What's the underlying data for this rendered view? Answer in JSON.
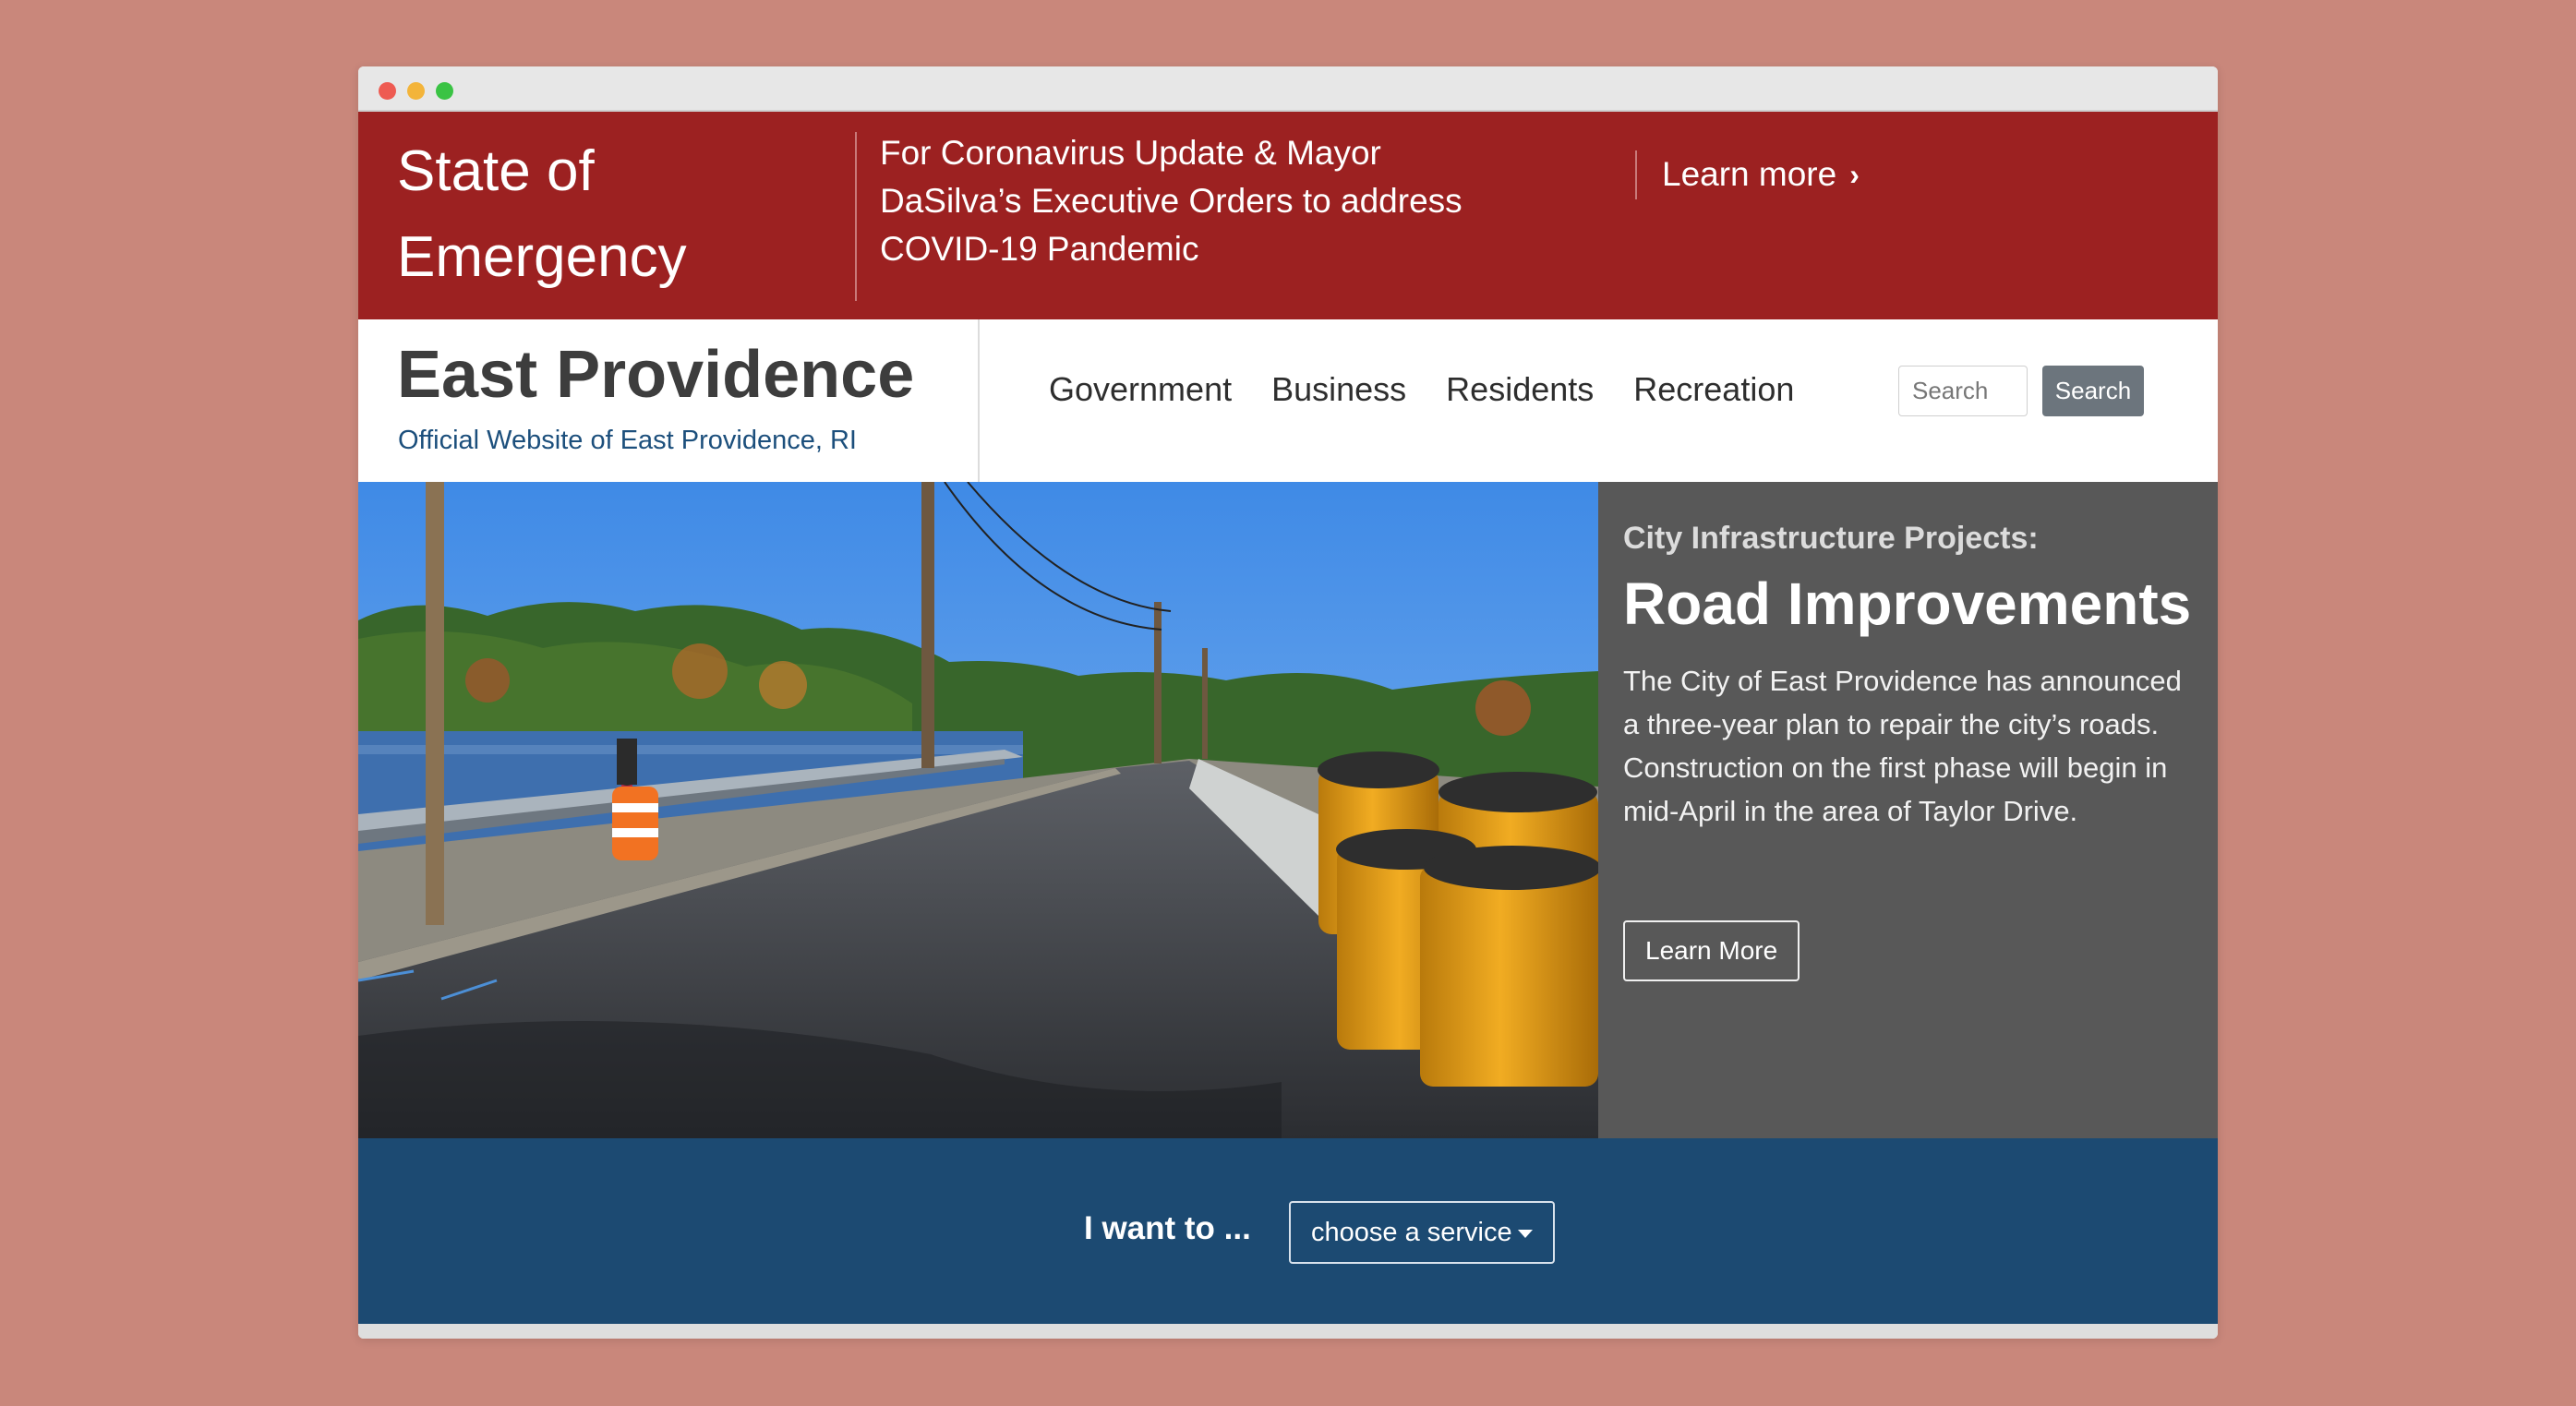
{
  "window": {
    "controls": [
      "close",
      "minimize",
      "maximize"
    ]
  },
  "alert_banner": {
    "title": "State of Emergency",
    "message": "For Coronavirus Update & Mayor DaSilva’s Executive Orders to address COVID-19 Pandemic",
    "link_label": "Learn more",
    "link_icon": "chevron-right-icon",
    "background_color": "#9c2121"
  },
  "header": {
    "site_title": "East Providence",
    "site_subtitle": "Official Website of East Providence, RI",
    "nav": [
      "Government",
      "Business",
      "Residents",
      "Recreation"
    ],
    "search": {
      "placeholder": "Search",
      "button_label": "Search"
    }
  },
  "hero": {
    "image_description_icon": "road-photo",
    "kicker": "City Infrastructure Projects:",
    "headline": "Road Improvements",
    "body": "The City of East Providence has announced a three-year plan to repair the city’s roads. Construction on the first phase will begin in mid-April in the area of Taylor Drive.",
    "button_label": "Learn More",
    "panel_color": "#585858"
  },
  "service_bar": {
    "label": "I want to ...",
    "select_value": "choose a service",
    "background_color": "#1c4a72"
  }
}
